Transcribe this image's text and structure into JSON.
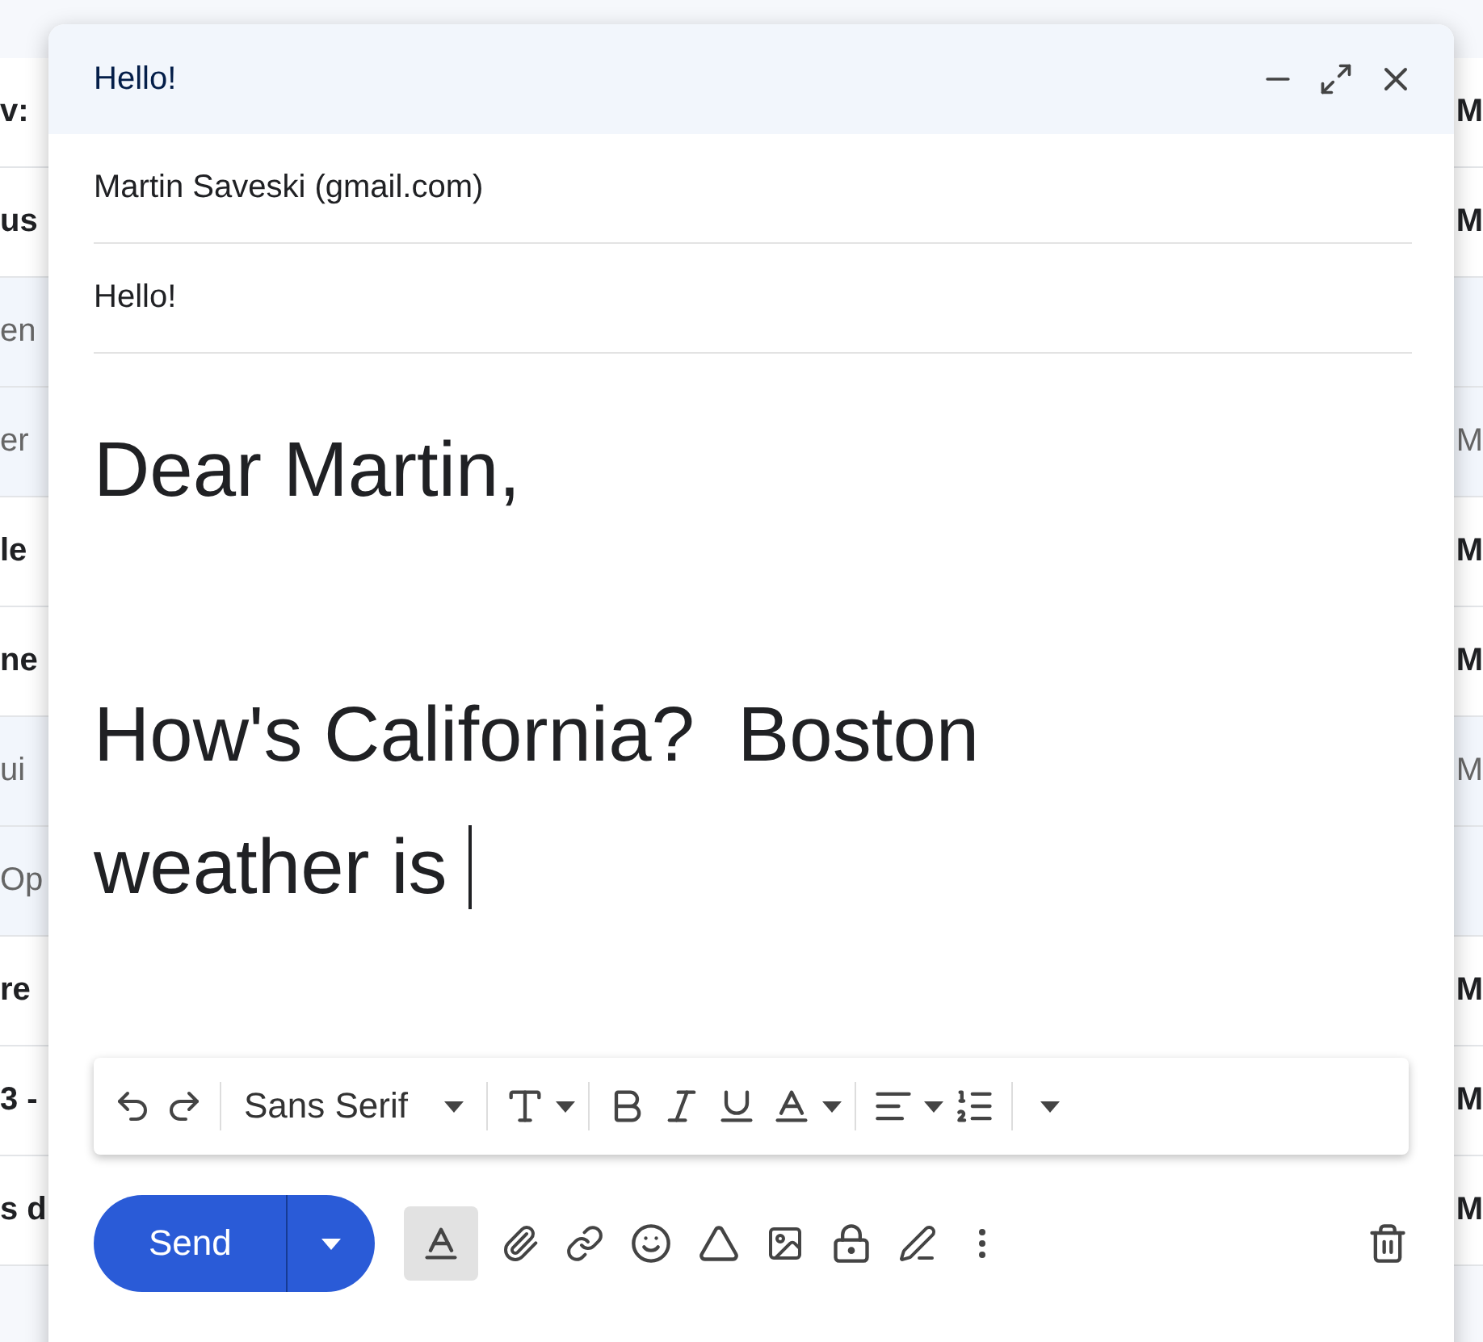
{
  "inbox_rows": [
    {
      "left": "v:",
      "right": "M",
      "read": false
    },
    {
      "left": "us",
      "right": "M",
      "read": false
    },
    {
      "left": "en",
      "read": true
    },
    {
      "left": "er",
      "right": "M",
      "read": true
    },
    {
      "left": "le",
      "right": "M",
      "read": false
    },
    {
      "left": "ne",
      "right": "M",
      "read": false
    },
    {
      "left": "ui",
      "right": "M",
      "read": true
    },
    {
      "left": "Op",
      "read": true
    },
    {
      "left": "re",
      "right": "M",
      "read": false
    },
    {
      "left": "3 -",
      "right": "M",
      "read": false
    },
    {
      "left": "s d",
      "right": "M",
      "read": false
    }
  ],
  "compose": {
    "title": "Hello!",
    "to": "Martin Saveski (gmail.com)",
    "subject": "Hello!",
    "body": [
      "Dear Martin,",
      "How's California?  Boston weather is "
    ],
    "font": "Sans Serif",
    "send": "Send",
    "formatting_selected": true
  }
}
